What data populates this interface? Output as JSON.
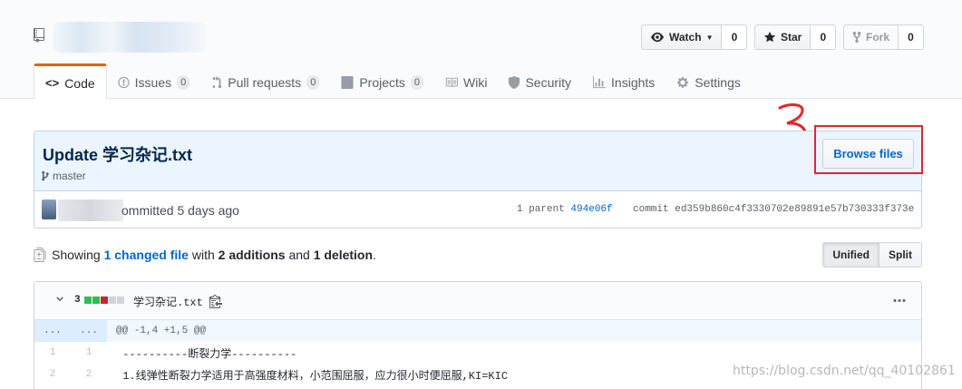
{
  "repo": {
    "icon": "repo-icon",
    "actions": {
      "watch": {
        "label": "Watch",
        "icon": "eye-icon",
        "count": "0"
      },
      "star": {
        "label": "Star",
        "icon": "star-icon",
        "count": "0"
      },
      "fork": {
        "label": "Fork",
        "icon": "fork-icon",
        "count": "0"
      }
    }
  },
  "tabs": [
    {
      "label": "Code",
      "icon": "code-icon",
      "counter": null,
      "selected": true
    },
    {
      "label": "Issues",
      "icon": "issue-icon",
      "counter": "0"
    },
    {
      "label": "Pull requests",
      "icon": "pull-request-icon",
      "counter": "0"
    },
    {
      "label": "Projects",
      "icon": "project-icon",
      "counter": "0"
    },
    {
      "label": "Wiki",
      "icon": "book-icon",
      "counter": null
    },
    {
      "label": "Security",
      "icon": "shield-icon",
      "counter": null
    },
    {
      "label": "Insights",
      "icon": "graph-icon",
      "counter": null
    },
    {
      "label": "Settings",
      "icon": "gear-icon",
      "counter": null
    }
  ],
  "annotation": {
    "text": "3",
    "color": "#e3262a"
  },
  "commit": {
    "title": "Update 学习杂记.txt",
    "branch": "master",
    "browse_label": "Browse files",
    "committed_text": "ommitted 5 days ago",
    "parent_prefix": "1 parent",
    "parent_sha": "494e06f",
    "commit_prefix": "commit",
    "commit_sha": "ed359b860c4f3330702e89891e57b730333f373e"
  },
  "toc": {
    "showing": "Showing",
    "changed_link": "1 changed file",
    "with": "with",
    "additions": "2 additions",
    "and": "and",
    "deletions": "1 deletion",
    "period": ".",
    "view_unified": "Unified",
    "view_split": "Split"
  },
  "file": {
    "diffstat_count": "3",
    "diffstat_blocks": [
      "added",
      "added",
      "deleted",
      "neutral",
      "neutral"
    ],
    "name": "学习杂记.txt",
    "more_icon": "kebab-horizontal-icon",
    "hunk": {
      "left": "...",
      "right": "...",
      "header": "@@ -1,4 +1,5 @@"
    },
    "lines": [
      {
        "old": "1",
        "new": "1",
        "text": " ----------断裂力学----------"
      },
      {
        "old": "2",
        "new": "2",
        "text": " 1.线弹性断裂力学适用于高强度材料，小范围屈服，应力很小时便屈服,KI=KIC"
      }
    ]
  },
  "colors": {
    "added": "#2cbe4e",
    "deleted": "#cb2431",
    "neutral": "#d1d5da",
    "accent": "#e36209",
    "link": "#0366d6"
  },
  "watermark": "https://blog.csdn.net/qq_40102861"
}
